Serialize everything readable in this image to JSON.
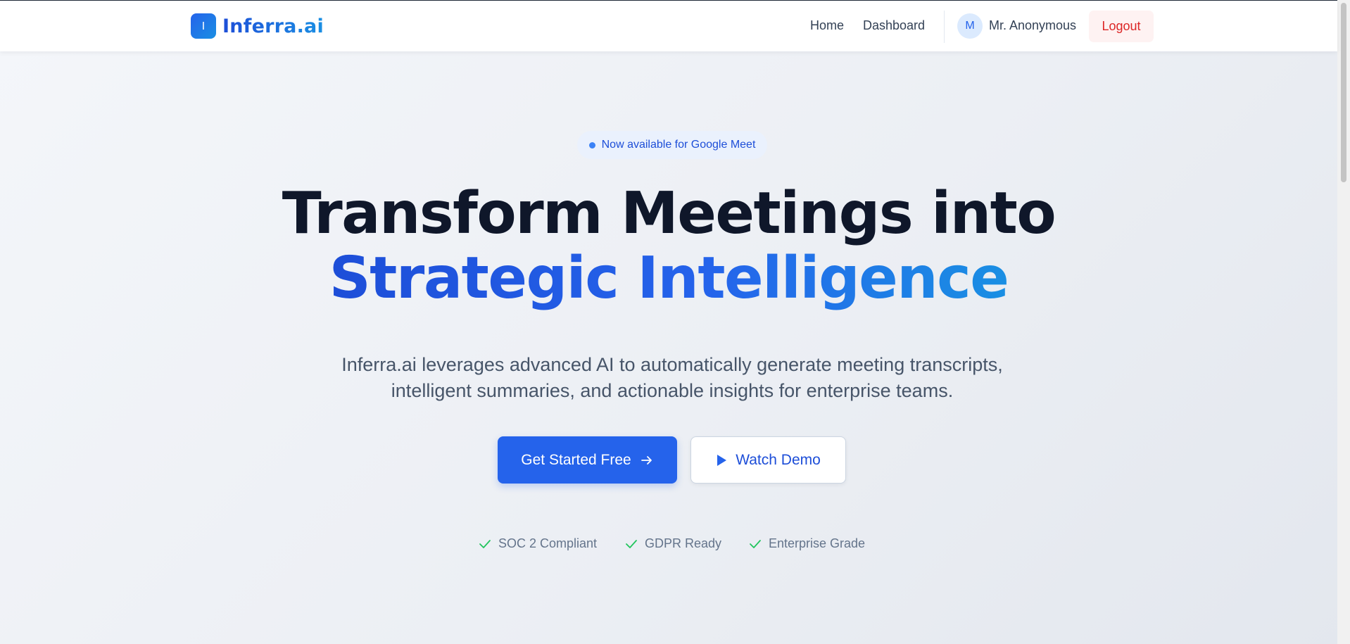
{
  "brand": {
    "mark": "I",
    "name": "Inferra.ai"
  },
  "nav": {
    "home": "Home",
    "dashboard": "Dashboard",
    "user_initial": "M",
    "user_name": "Mr. Anonymous",
    "logout": "Logout"
  },
  "hero": {
    "badge": "Now available for Google Meet",
    "headline_line1": "Transform Meetings into",
    "headline_line2": "Strategic Intelligence",
    "subtitle": "Inferra.ai leverages advanced AI to automatically generate meeting transcripts, intelligent summaries, and actionable insights for enterprise teams.",
    "primary_cta": "Get Started Free",
    "secondary_cta": "Watch Demo"
  },
  "trust_badges": [
    "SOC 2 Compliant",
    "GDPR Ready",
    "Enterprise Grade"
  ],
  "icons": {
    "cta_arrow": "arrow-right-icon",
    "demo_play": "play-icon",
    "trust_check": "check-icon"
  },
  "colors": {
    "accent": "#2563eb",
    "accent_light": "#1a8fe3",
    "logout": "#dc2626",
    "check": "#22c55e"
  }
}
